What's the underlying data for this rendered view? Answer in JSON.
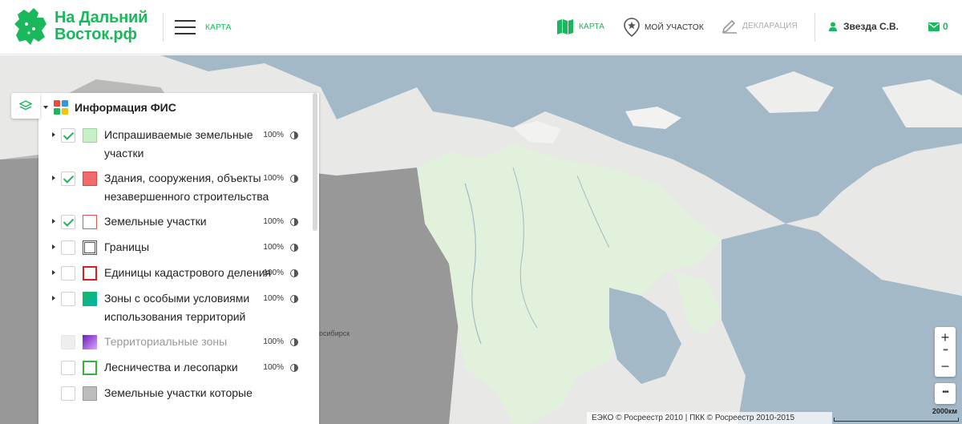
{
  "header": {
    "logo_line1": "На Дальний",
    "logo_line2": "Восток.рф",
    "menu_label": "КАРТА",
    "nav": {
      "map": "КАРТА",
      "my_plot": "МОЙ УЧАСТОК",
      "declaration": "ДЕКЛАРАЦИЯ"
    },
    "user_name": "Звезда С.В.",
    "mail_count": "0"
  },
  "colors": {
    "brand_green": "#1ab85c",
    "sea": "#a4b9c8",
    "land": "#e8e8e6",
    "far_east_highlight": "#e1f1dc"
  },
  "layer_panel": {
    "group_title": "Информация ФИС",
    "layers": [
      {
        "name_line1": "Испрашиваемые земельные",
        "name_line2": "участки",
        "opacity": "100%",
        "checked": true,
        "has_expander": true,
        "disabled": false,
        "swatch": "requested"
      },
      {
        "name_line1": "Здания, сооружения, объекты",
        "name_line2": "незавершенного строительства",
        "opacity": "100%",
        "checked": true,
        "has_expander": true,
        "disabled": false,
        "swatch": "buildings"
      },
      {
        "name_line1": "Земельные участки",
        "opacity": "100%",
        "checked": true,
        "has_expander": true,
        "disabled": false,
        "swatch": "land-plots"
      },
      {
        "name_line1": "Границы",
        "opacity": "100%",
        "checked": false,
        "has_expander": true,
        "disabled": false,
        "swatch": "borders"
      },
      {
        "name_line1": "Единицы кадастрового деления",
        "opacity": "100%",
        "checked": false,
        "has_expander": true,
        "disabled": false,
        "swatch": "cadastral-units"
      },
      {
        "name_line1": "Зоны с особыми условиями",
        "name_line2": "использования территорий",
        "opacity": "100%",
        "checked": false,
        "has_expander": true,
        "disabled": false,
        "swatch": "special-zones"
      },
      {
        "name_line1": "Территориальные зоны",
        "opacity": "100%",
        "checked": false,
        "has_expander": false,
        "disabled": true,
        "swatch": "territorial-zones"
      },
      {
        "name_line1": "Лесничества и лесопарки",
        "opacity": "100%",
        "checked": false,
        "has_expander": false,
        "disabled": false,
        "swatch": "forestry"
      },
      {
        "name_line1": "Земельные участки которые",
        "checked": false,
        "has_expander": false,
        "disabled": false,
        "swatch": "other-plots"
      }
    ]
  },
  "map": {
    "city_label": "осибирск",
    "attribution": "ЕЭКО © Росреестр 2010 | ПКК © Росреестр 2010-2015",
    "scale_label": "2000км",
    "zoom_in": "+",
    "zoom_out": "−"
  }
}
